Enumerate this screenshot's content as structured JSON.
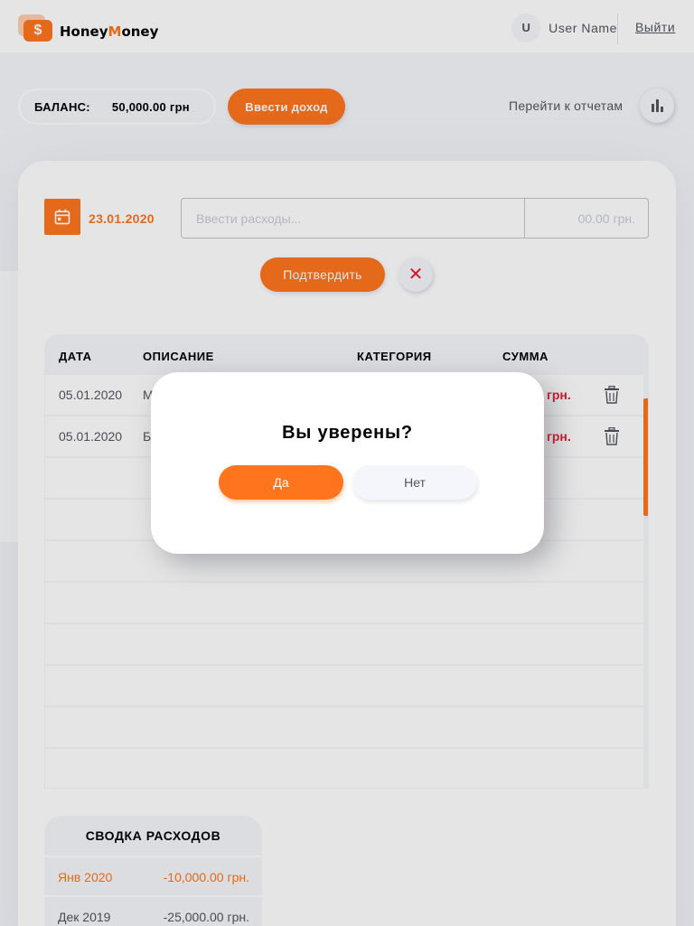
{
  "header": {
    "logo_symbol": "$",
    "logo_part1": "Honey",
    "logo_part2": "M",
    "logo_part3": "oney",
    "avatar_letter": "U",
    "user_name": "User Name",
    "logout_label": "Выйти"
  },
  "balance": {
    "label": "БАЛАНС:",
    "value": "50,000.00 грн",
    "income_button": "Ввести доход",
    "reports_link": "Перейти к отчетам",
    "reports_icon": "bar-chart-icon"
  },
  "form": {
    "date": "23.01.2020",
    "calendar_icon": "calendar-icon",
    "expense_placeholder": "Ввести расходы...",
    "sum_placeholder": "00.00 грн.",
    "confirm_label": "Подтвердить",
    "clear_symbol": "✕"
  },
  "table": {
    "headers": [
      "ДАТА",
      "ОПИСАНИЕ",
      "КАТЕГОРИЯ",
      "СУММА"
    ],
    "rows": [
      {
        "date": "05.01.2020",
        "desc": "М",
        "amount": "грн."
      },
      {
        "date": "05.01.2020",
        "desc": "Б",
        "amount": "грн."
      }
    ]
  },
  "summary": {
    "title": "СВОДКА РАСХОДОВ",
    "rows": [
      {
        "month": "Янв 2020",
        "value": "-10,000.00 грн."
      },
      {
        "month": "Дек 2019",
        "value": "-25,000.00 грн."
      }
    ]
  },
  "modal": {
    "question": "Вы уверены?",
    "yes_label": "Да",
    "no_label": "Нет"
  },
  "colors": {
    "accent": "#ff751d",
    "danger": "#e7192e",
    "background": "#f5f6fb",
    "text": "#52555f"
  }
}
